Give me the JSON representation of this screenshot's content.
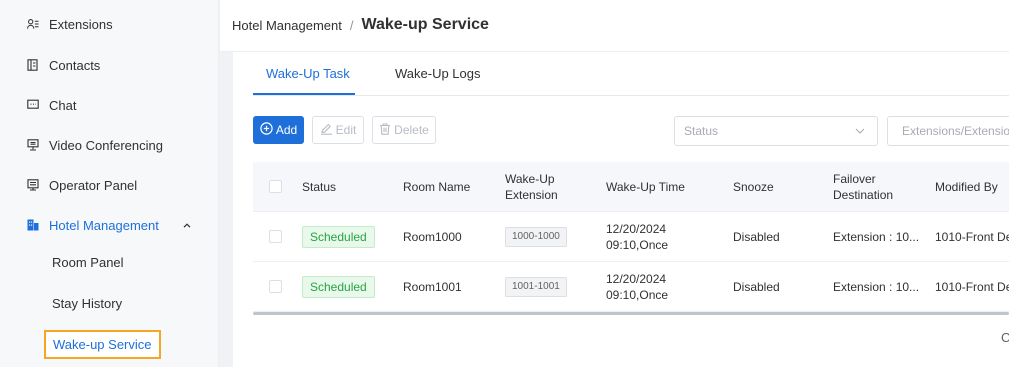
{
  "sidebar": {
    "items": [
      {
        "label": "Extensions",
        "icon": "extensions-icon"
      },
      {
        "label": "Contacts",
        "icon": "contacts-icon"
      },
      {
        "label": "Chat",
        "icon": "chat-icon"
      },
      {
        "label": "Video Conferencing",
        "icon": "video-conferencing-icon"
      },
      {
        "label": "Operator Panel",
        "icon": "operator-panel-icon"
      },
      {
        "label": "Hotel Management",
        "icon": "hotel-icon",
        "expanded": true
      }
    ],
    "sub_items": [
      {
        "label": "Room Panel"
      },
      {
        "label": "Stay History"
      },
      {
        "label": "Wake-up Service",
        "current": true
      }
    ]
  },
  "breadcrumb": {
    "parent": "Hotel Management",
    "separator": "/",
    "current": "Wake-up Service"
  },
  "tabs": [
    {
      "label": "Wake-Up Task",
      "active": true
    },
    {
      "label": "Wake-Up Logs",
      "active": false
    }
  ],
  "toolbar": {
    "add_label": "Add",
    "edit_label": "Edit",
    "delete_label": "Delete",
    "status_placeholder": "Status",
    "search_placeholder": "Extensions/Extension"
  },
  "table": {
    "headers": {
      "status": "Status",
      "room_name": "Room Name",
      "wakeup_ext_1": "Wake-Up",
      "wakeup_ext_2": "Extension",
      "wakeup_time": "Wake-Up Time",
      "snooze": "Snooze",
      "failover_1": "Failover",
      "failover_2": "Destination",
      "modified_by": "Modified By"
    },
    "rows": [
      {
        "status": "Scheduled",
        "room_name": "Room1000",
        "extension": "1000-1000",
        "time_1": "12/20/2024",
        "time_2": "09:10,Once",
        "snooze": "Disabled",
        "failover": "Extension : 10...",
        "modified_by": "1010-Front De"
      },
      {
        "status": "Scheduled",
        "room_name": "Room1001",
        "extension": "1001-1001",
        "time_1": "12/20/2024",
        "time_2": "09:10,Once",
        "snooze": "Disabled",
        "failover": "Extension : 10...",
        "modified_by": "1010-Front De"
      }
    ]
  },
  "pager": {
    "partial_text": "C"
  },
  "colors": {
    "accent": "#1e6fd9",
    "scheduled_green": "#26a541",
    "highlight_border": "#f5a623"
  }
}
